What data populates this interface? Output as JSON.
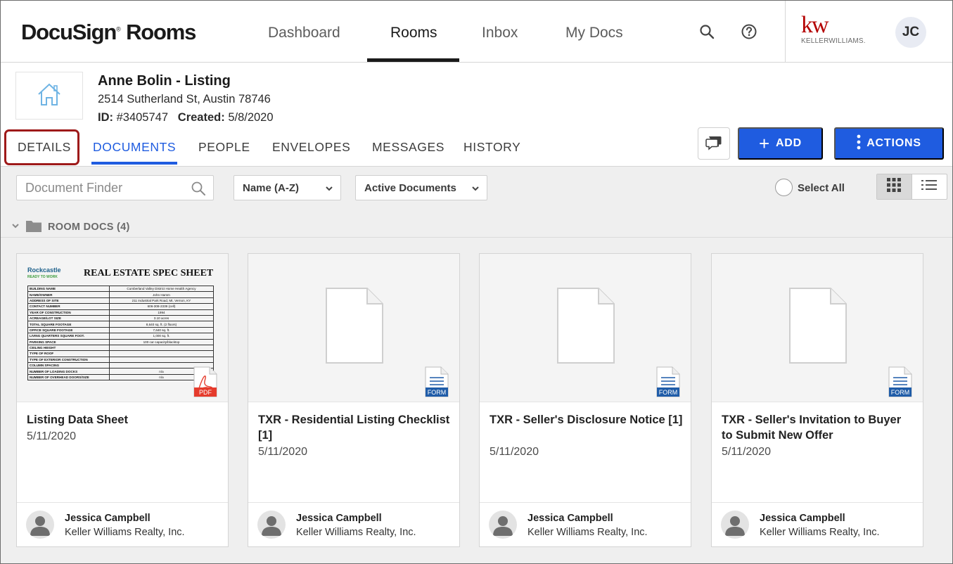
{
  "brand": {
    "logo_main": "DocuSign",
    "logo_reg": "®",
    "logo_rooms": " Rooms",
    "partner_mark": "kw",
    "partner_text": "KELLERWILLIAMS."
  },
  "nav": {
    "items": [
      "Dashboard",
      "Rooms",
      "Inbox",
      "My Docs"
    ],
    "active": "Rooms",
    "user_initials": "JC"
  },
  "room": {
    "title": "Anne Bolin - Listing",
    "address": "2514 Sutherland St, Austin 78746",
    "id_label": "ID:",
    "id_value": "#3405747",
    "created_label": "Created:",
    "created_value": "5/8/2020"
  },
  "tabs": {
    "items": [
      "DETAILS",
      "DOCUMENTS",
      "PEOPLE",
      "ENVELOPES",
      "MESSAGES",
      "HISTORY"
    ],
    "active": "DOCUMENTS",
    "highlighted": "DETAILS"
  },
  "actions": {
    "add_label": "ADD",
    "actions_label": "ACTIONS"
  },
  "toolbar": {
    "finder_placeholder": "Document Finder",
    "sort_value": "Name (A-Z)",
    "filter_value": "Active Documents",
    "select_all": "Select All"
  },
  "folder": {
    "label": "ROOM DOCS (4)"
  },
  "documents": [
    {
      "name": "Listing Data Sheet",
      "date": "5/11/2020",
      "type": "PDF",
      "owner": "Jessica Campbell",
      "org": "Keller Williams Realty, Inc."
    },
    {
      "name": "TXR - Residential Listing Checklist [1]",
      "date": "5/11/2020",
      "type": "FORM",
      "owner": "Jessica Campbell",
      "org": "Keller Williams Realty, Inc."
    },
    {
      "name": "TXR - Seller's Disclosure Notice [1]",
      "date": "5/11/2020",
      "type": "FORM",
      "owner": "Jessica Campbell",
      "org": "Keller Williams Realty, Inc."
    },
    {
      "name": "TXR - Seller's Invitation to Buyer to Submit New Offer",
      "date": "5/11/2020",
      "type": "FORM",
      "owner": "Jessica Campbell",
      "org": "Keller Williams Realty, Inc."
    }
  ],
  "spec_sheet": {
    "logo": "Rockcastle",
    "logo_sub": "READY TO WORK",
    "title": "REAL ESTATE SPEC SHEET",
    "rows": [
      [
        "BUILDING NAME",
        "Cumberland Valley District Home Health Agency"
      ],
      [
        "NAME/OWNER",
        "John Hamm"
      ],
      [
        "ADDRESS OF SITE",
        "211 Industrial Park Road, Mt. Vernon, KY"
      ],
      [
        "CONTACT NUMBER",
        "606-308-2339 (cell)"
      ],
      [
        "YEAR OF CONSTRUCTION",
        "1994"
      ],
      [
        "ACREAGE/LOT SIZE",
        "3.10 acres"
      ],
      [
        "TOTAL SQUARE FOOTAGE",
        "8,640 sq. ft. (2 floors)"
      ],
      [
        "   OFFICE SQUARE FOOTAGE",
        "7,640 sq. ft."
      ],
      [
        "   LIVING QUARTERS SQUARE FOOT.",
        "1,000 sq. ft."
      ],
      [
        "PARKING SPACE",
        "100 car capacity/blacktop"
      ],
      [
        "CEILING HEIGHT",
        ""
      ],
      [
        "TYPE OF ROOF",
        ""
      ],
      [
        "TYPE OF EXTERIOR CONSTRUCTION",
        ""
      ],
      [
        "COLUMN SPACING",
        ""
      ],
      [
        "NUMBER OF LOADING DOCKS",
        "n/a"
      ],
      [
        "NUMBER OF OVERHEAD DOORS/SIZE",
        "n/a"
      ]
    ]
  },
  "colors": {
    "accent": "#1f5ce0",
    "highlight": "#9e1a1a",
    "partner": "#b40101",
    "pdf_badge": "#e53b2c",
    "form_badge": "#1f5ca8"
  }
}
